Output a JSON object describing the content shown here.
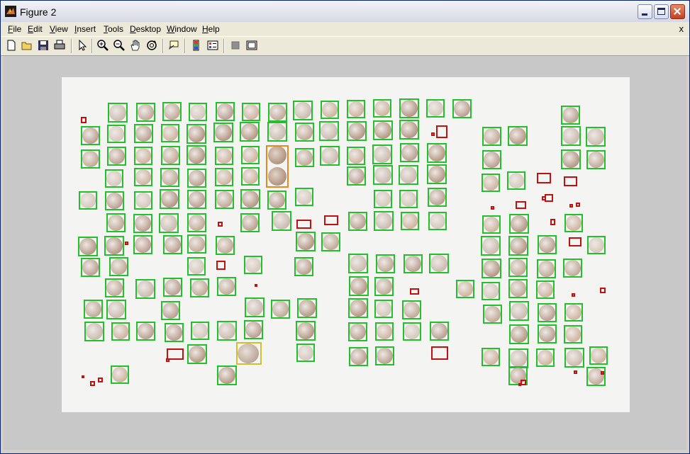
{
  "window": {
    "title": "Figure 2"
  },
  "menu": [
    {
      "label": "File",
      "u": "F",
      "rest": "ile"
    },
    {
      "label": "Edit",
      "u": "E",
      "rest": "dit"
    },
    {
      "label": "View",
      "u": "V",
      "rest": "iew"
    },
    {
      "label": "Insert",
      "u": "I",
      "rest": "nsert"
    },
    {
      "label": "Tools",
      "u": "T",
      "rest": "ools"
    },
    {
      "label": "Desktop",
      "u": "D",
      "rest": "esktop"
    },
    {
      "label": "Window",
      "u": "W",
      "rest": "indow"
    },
    {
      "label": "Help",
      "u": "H",
      "rest": "elp"
    }
  ],
  "menubar_close": "x",
  "toolbar": [
    "new-file-icon",
    "open-folder-icon",
    "save-icon",
    "print-icon",
    "arrow-pointer-icon",
    "zoom-in-icon",
    "zoom-out-icon",
    "pan-hand-icon",
    "rotate-3d-icon",
    "data-cursor-icon",
    "colorbar-icon",
    "legend-icon",
    "hide-plot-tools-icon",
    "show-plot-tools-icon"
  ],
  "colors": {
    "detected": "#22c02a",
    "rejected": "#c01010",
    "ambiguous": "#e08a20",
    "selected": "#d0c030"
  }
}
